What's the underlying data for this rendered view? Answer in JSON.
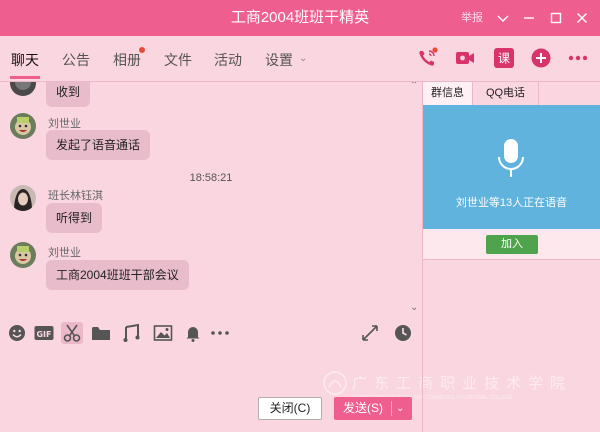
{
  "window": {
    "title": "工商2004班班干精英",
    "report_label": "举报"
  },
  "tabs": [
    {
      "label": "聊天",
      "active": true
    },
    {
      "label": "公告"
    },
    {
      "label": "相册",
      "badge": true
    },
    {
      "label": "文件"
    },
    {
      "label": "活动"
    },
    {
      "label": "设置"
    }
  ],
  "tab_icons": [
    "voice-call-icon",
    "video-call-icon",
    "lesson-icon",
    "add-app-icon",
    "more-icon"
  ],
  "messages": [
    {
      "text": "收到"
    },
    {
      "sender": "刘世业",
      "text": "发起了语音通话"
    },
    {
      "timestamp": "18:58:21"
    },
    {
      "sender": "班长林钰淇",
      "text": "听得到"
    },
    {
      "sender": "刘世业",
      "text": "工商2004班班干部会议"
    }
  ],
  "toolbar_icons": [
    "emoji-icon",
    "gif-icon",
    "scissors-icon",
    "folder-icon",
    "music-icon",
    "image-icon",
    "bell-icon",
    "more-icon",
    "expand-icon",
    "history-icon"
  ],
  "buttons": {
    "close": "关闭(C)",
    "send": "发送(S)"
  },
  "right_panel": {
    "tabs": [
      "群信息",
      "QQ电话"
    ],
    "active_tab": "群信息",
    "voice_status": "刘世业等13人正在语音",
    "join": "加入"
  },
  "watermark": {
    "chinese": "广东工商职业技术学院",
    "english": "GUANGDONG INDUSTRY AND COMMERCE VOCATIONAL COLLEGE"
  },
  "colors": {
    "titlebar": "#ee5e8e",
    "background": "#fad6e1",
    "voice_panel": "#5fb3dd",
    "join_button": "#4ea34c"
  }
}
